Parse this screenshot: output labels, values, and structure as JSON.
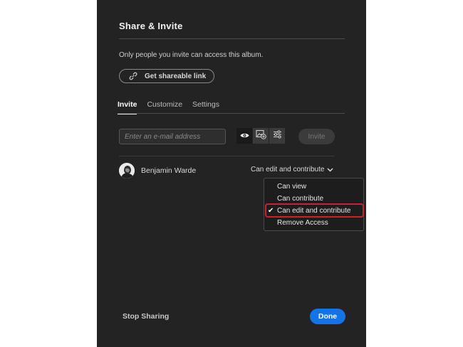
{
  "dialog": {
    "title": "Share & Invite",
    "description": "Only people you invite can access this album.",
    "shareable_link_label": "Get shareable link",
    "tabs": [
      {
        "label": "Invite",
        "active": true
      },
      {
        "label": "Customize",
        "active": false
      },
      {
        "label": "Settings",
        "active": false
      }
    ],
    "email": {
      "placeholder": "Enter an e-mail address",
      "value": ""
    },
    "permission_icons": [
      "eye-icon",
      "add-photo-icon",
      "sliders-icon"
    ],
    "invite_label": "Invite"
  },
  "member": {
    "name": "Benjamin Warde",
    "role": "Can edit and contribute"
  },
  "dropdown": {
    "items": [
      {
        "label": "Can view",
        "selected": false
      },
      {
        "label": "Can contribute",
        "selected": false
      },
      {
        "label": "Can edit and contribute",
        "selected": true
      },
      {
        "label": "Remove Access",
        "selected": false
      }
    ],
    "check_glyph": "✔"
  },
  "footer": {
    "stop_sharing_label": "Stop Sharing",
    "done_label": "Done"
  },
  "colors": {
    "panel_bg": "#232323",
    "accent_blue": "#1473e6",
    "highlight_red": "#d21f2c"
  }
}
